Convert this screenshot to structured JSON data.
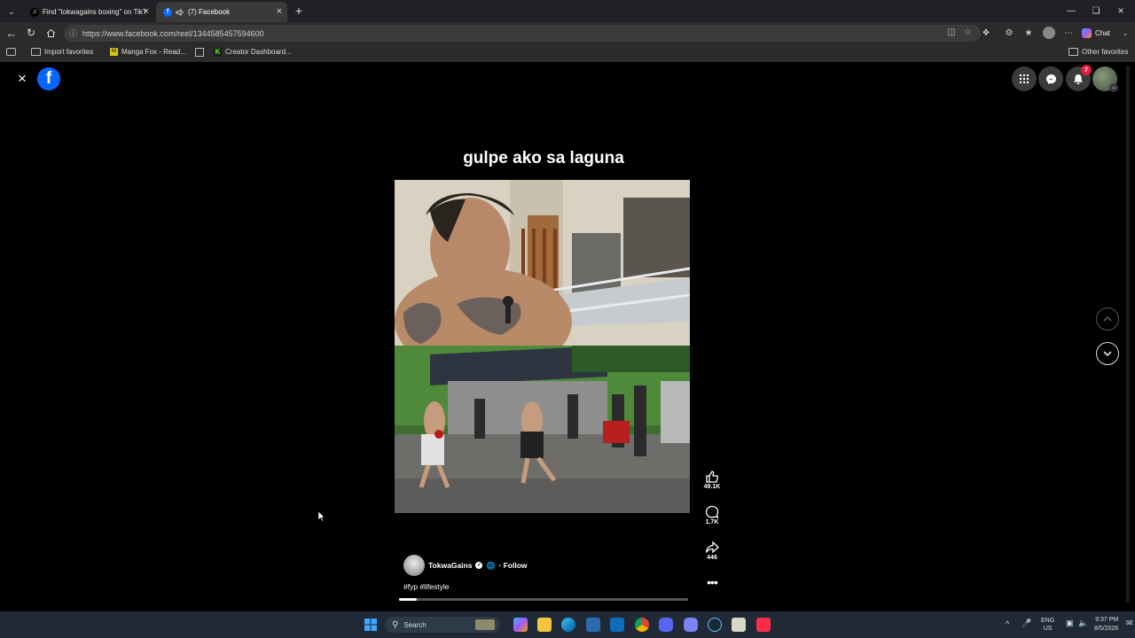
{
  "browser": {
    "tabs": [
      {
        "label": "Find \"tokwagains boxing\" on TikTo",
        "favicon": "tiktok-icon"
      },
      {
        "label": "(7) Facebook",
        "favicon": "facebook-icon"
      }
    ],
    "url": "https://www.facebook.com/reel/1344585457594600",
    "chat_label": "Chat",
    "favorites": [
      "Import favorites",
      "Manga Fox - Read...",
      "Creator Dashboard..."
    ],
    "other_favorites": "Other favorites"
  },
  "facebook": {
    "notification_count": "7",
    "reel": {
      "caption_title": "gulpe ako sa laguna",
      "author": "TokwaGains",
      "follow_label": "· Follow",
      "hashtags": "#fyp #lifestyle",
      "progress": 0.06,
      "likes": "49.1K",
      "comments": "1.7K",
      "shares": "446"
    }
  },
  "taskbar": {
    "search_placeholder": "Search",
    "lang_line1": "ENG",
    "lang_line2": "US",
    "time": "9:37 PM",
    "date": "8/5/2026"
  },
  "colors": {
    "facebook_blue": "#0866ff",
    "badge_red": "#e41e3f",
    "tab_active": "#3a3a3a"
  }
}
